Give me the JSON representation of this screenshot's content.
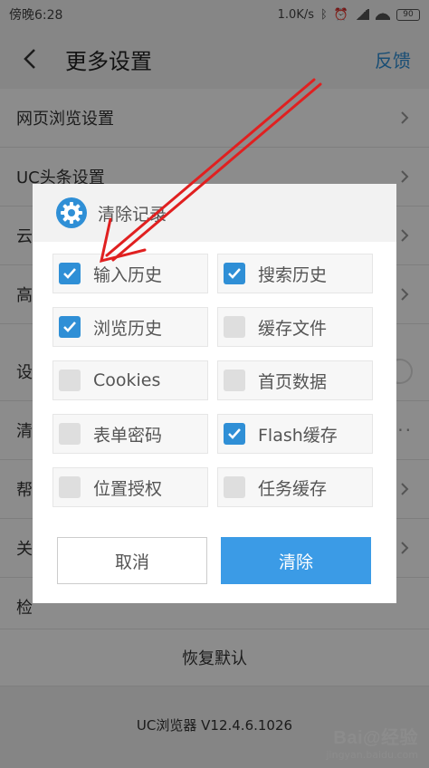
{
  "status_bar": {
    "time": "傍晚6:28",
    "speed": "1.0K/s",
    "battery": "90"
  },
  "header": {
    "title": "更多设置",
    "feedback": "反馈"
  },
  "settings": [
    {
      "label": "网页浏览设置",
      "control": "chevron"
    },
    {
      "label": "UC头条设置",
      "control": "chevron"
    },
    {
      "label": "云",
      "control": "chevron"
    },
    {
      "label": "高",
      "control": "chevron"
    },
    {
      "label": "设",
      "control": "toggle"
    },
    {
      "label": "清",
      "control": "dots"
    },
    {
      "label": "帮",
      "control": "chevron"
    },
    {
      "label": "关",
      "control": "chevron"
    },
    {
      "label": "检",
      "control": "none"
    }
  ],
  "restore_label": "恢复默认",
  "version": "UC浏览器 V12.4.6.1026",
  "watermark": {
    "logo": "Bai@经验",
    "sub": "jingyan.baidu.com"
  },
  "dialog": {
    "title": "清除记录",
    "options": [
      {
        "label": "输入历史",
        "checked": true
      },
      {
        "label": "搜索历史",
        "checked": true
      },
      {
        "label": "浏览历史",
        "checked": true
      },
      {
        "label": "缓存文件",
        "checked": false
      },
      {
        "label": "Cookies",
        "checked": false
      },
      {
        "label": "首页数据",
        "checked": false
      },
      {
        "label": "表单密码",
        "checked": false
      },
      {
        "label": "Flash缓存",
        "checked": true
      },
      {
        "label": "位置授权",
        "checked": false
      },
      {
        "label": "任务缓存",
        "checked": false
      }
    ],
    "cancel_label": "取消",
    "clear_label": "清除"
  },
  "colors": {
    "accent": "#2f8fd6",
    "annotation_arrow": "#e02020"
  }
}
